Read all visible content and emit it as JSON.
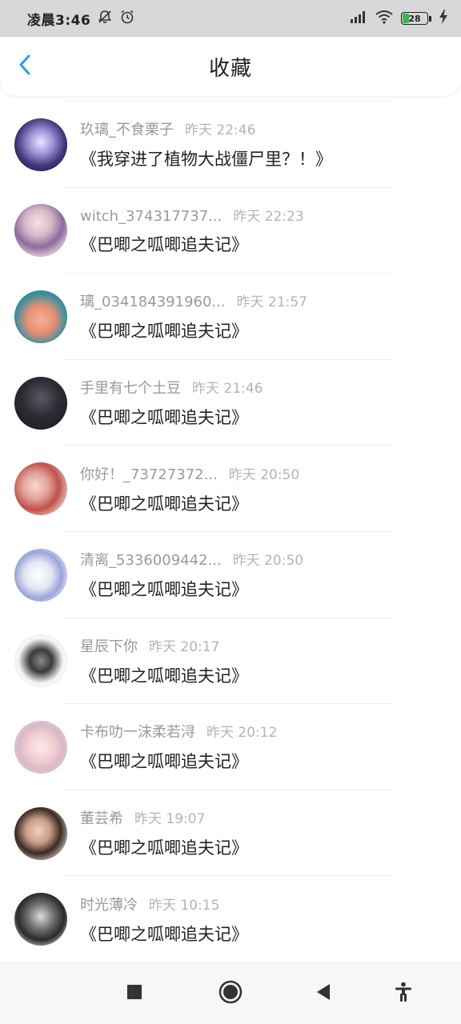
{
  "status_bar": {
    "time": "凌晨3:46",
    "battery_level": "28",
    "battery_fraction": 0.28,
    "icons": [
      "mute-bell-icon",
      "alarm-icon",
      "signal-icon",
      "wifi-icon",
      "battery-icon",
      "charging-icon"
    ]
  },
  "nav": {
    "title": "收藏",
    "back_icon": "chevron-left-icon"
  },
  "accent_color": "#2a9fe0",
  "favorites": [
    {
      "username": "玖璃_不食栗子",
      "time": "昨天 22:46",
      "title": "《我穿进了植物大战僵尸里？！》"
    },
    {
      "username": "witch_374317737...",
      "time": "昨天 22:23",
      "title": "《巴唧之呱唧追夫记》"
    },
    {
      "username": "璃_034184391960...",
      "time": "昨天 21:57",
      "title": "《巴唧之呱唧追夫记》"
    },
    {
      "username": "手里有七个土豆",
      "time": "昨天 21:46",
      "title": "《巴唧之呱唧追夫记》"
    },
    {
      "username": "你好！_73727372...",
      "time": "昨天 20:50",
      "title": "《巴唧之呱唧追夫记》"
    },
    {
      "username": "清离_5336009442...",
      "time": "昨天 20:50",
      "title": "《巴唧之呱唧追夫记》"
    },
    {
      "username": "星辰下你",
      "time": "昨天 20:17",
      "title": "《巴唧之呱唧追夫记》"
    },
    {
      "username": "卡布叻一沫柔若浔",
      "time": "昨天 20:12",
      "title": "《巴唧之呱唧追夫记》"
    },
    {
      "username": "董芸希",
      "time": "昨天 19:07",
      "title": "《巴唧之呱唧追夫记》"
    },
    {
      "username": "时光薄冷",
      "time": "昨天 10:15",
      "title": "《巴唧之呱唧追夫记》"
    }
  ],
  "system_nav": {
    "icons": [
      "recents-square-icon",
      "home-circle-icon",
      "back-triangle-icon",
      "accessibility-icon"
    ]
  }
}
